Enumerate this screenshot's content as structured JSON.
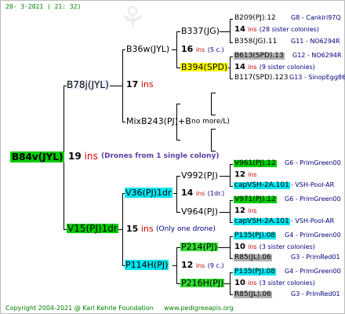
{
  "header": {
    "date": "20-  3-2021 (  21: 32)"
  },
  "footer": {
    "copyright": "Copyright 2004-2021 @ Karl Kehrle Foundation",
    "site": "www.pedigreeapis.org"
  },
  "root": {
    "name": "B84v(JYL)",
    "gen": "19",
    "ins": "ins",
    "note": "(Drones from 1 single colony)"
  },
  "mother": {
    "name": "B78j(JYL)",
    "gen": "17",
    "ins": "ins"
  },
  "father": {
    "name": "V15(PJ)1dr",
    "gen": "15",
    "ins": "ins",
    "note": "(Only one drone)"
  },
  "mm": {
    "name": "B36w(JYL)",
    "gen": "16",
    "ins": "ins",
    "note": "(5 c.)"
  },
  "mf": {
    "name": "MixB243(PJ)+B",
    "note": "no more/L)"
  },
  "fm": {
    "name": "V36(PJ)1dr",
    "gen": "14",
    "ins": "ins",
    "note": "(1dr.)"
  },
  "ff": {
    "name": "P114H(PJ)",
    "gen": "12",
    "ins": "ins",
    "note": "(9 c.)"
  },
  "mmm": {
    "name": "B337(JG)"
  },
  "mmf": {
    "name": "B394(SPD)"
  },
  "fmm": {
    "name": "V992(PJ)"
  },
  "fmf": {
    "name": "V964(PJ)"
  },
  "ffm": {
    "name": "P214(PJ)"
  },
  "fff": {
    "name": "P216H(PJ)"
  },
  "right": {
    "r1": {
      "name": "B209(PJ).12",
      "info": "G8 - Cankiri97Q"
    },
    "r2": {
      "gen": "14",
      "ins": "ins",
      "note": "(28 sister colonies)"
    },
    "r3": {
      "name": "B358(JG).11",
      "info": "G11 - NO6294R"
    },
    "r4": {
      "name": "B613(SPD).13",
      "info": "G12 - NO6294R"
    },
    "r5": {
      "gen": "14",
      "ins": "ins",
      "note": "(9 sister colonies)"
    },
    "r6": {
      "name": "B117(SPD).123",
      "info": "G13 - SinopEgg86R"
    },
    "r7": {
      "name": "V961(PJ).12",
      "info": "G6 - PrimGreen00"
    },
    "r8": {
      "gen": "12",
      "ins": "ins"
    },
    "r9": {
      "name": "capVSH-2A.101",
      "info": "- VSH-Pool-AR"
    },
    "r10": {
      "name": "V971(PJ).12",
      "info": "G6 - PrimGreen00"
    },
    "r11": {
      "gen": "12",
      "ins": "ins"
    },
    "r12": {
      "name": "capVSH-2A.101",
      "info": "- VSH-Pool-AR"
    },
    "r13": {
      "name": "P135(PJ).08",
      "info": "G4 - PrimGreen00"
    },
    "r14": {
      "gen": "10",
      "ins": "ins",
      "note": "(3 sister colonies)"
    },
    "r15": {
      "name": "R85(JL).06",
      "info": "G3 - PrimRed01"
    },
    "r16": {
      "name": "P135(PJ).08",
      "info": "G4 - PrimGreen00"
    },
    "r17": {
      "gen": "10",
      "ins": "ins",
      "note": "(3 sister colonies)"
    },
    "r18": {
      "name": "R85(JL).06",
      "info": "G3 - PrimRed01"
    }
  }
}
